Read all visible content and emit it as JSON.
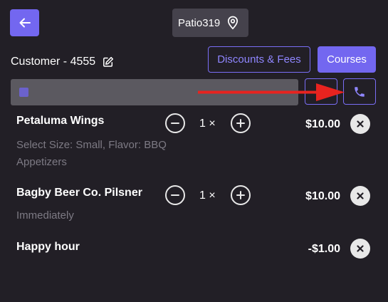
{
  "header": {
    "table_label": "Patio319",
    "customer_label": "Customer - 4555"
  },
  "actions": {
    "discounts_label": "Discounts & Fees",
    "courses_label": "Courses"
  },
  "note": {
    "value": ""
  },
  "icons": {
    "back": "arrow-left-icon",
    "location": "map-pin-icon",
    "edit": "edit-icon",
    "person": "person-icon",
    "phone": "phone-icon",
    "minus": "minus-circle-icon",
    "plus": "plus-circle-icon",
    "remove": "close-circle-icon"
  },
  "colors": {
    "background": "#221f26",
    "accent": "#7367f0",
    "annotation_arrow": "#e8231f"
  },
  "order_items": [
    {
      "name": "Petaluma Wings",
      "qty": "1",
      "times": "×",
      "price": "$10.00",
      "modifiers": [
        "Select Size: Small, Flavor: BBQ",
        "Appetizers"
      ]
    },
    {
      "name": "Bagby Beer Co. Pilsner",
      "qty": "1",
      "times": "×",
      "price": "$10.00",
      "modifiers": [
        "Immediately"
      ]
    },
    {
      "name": "Happy hour",
      "price": "-$1.00"
    }
  ]
}
